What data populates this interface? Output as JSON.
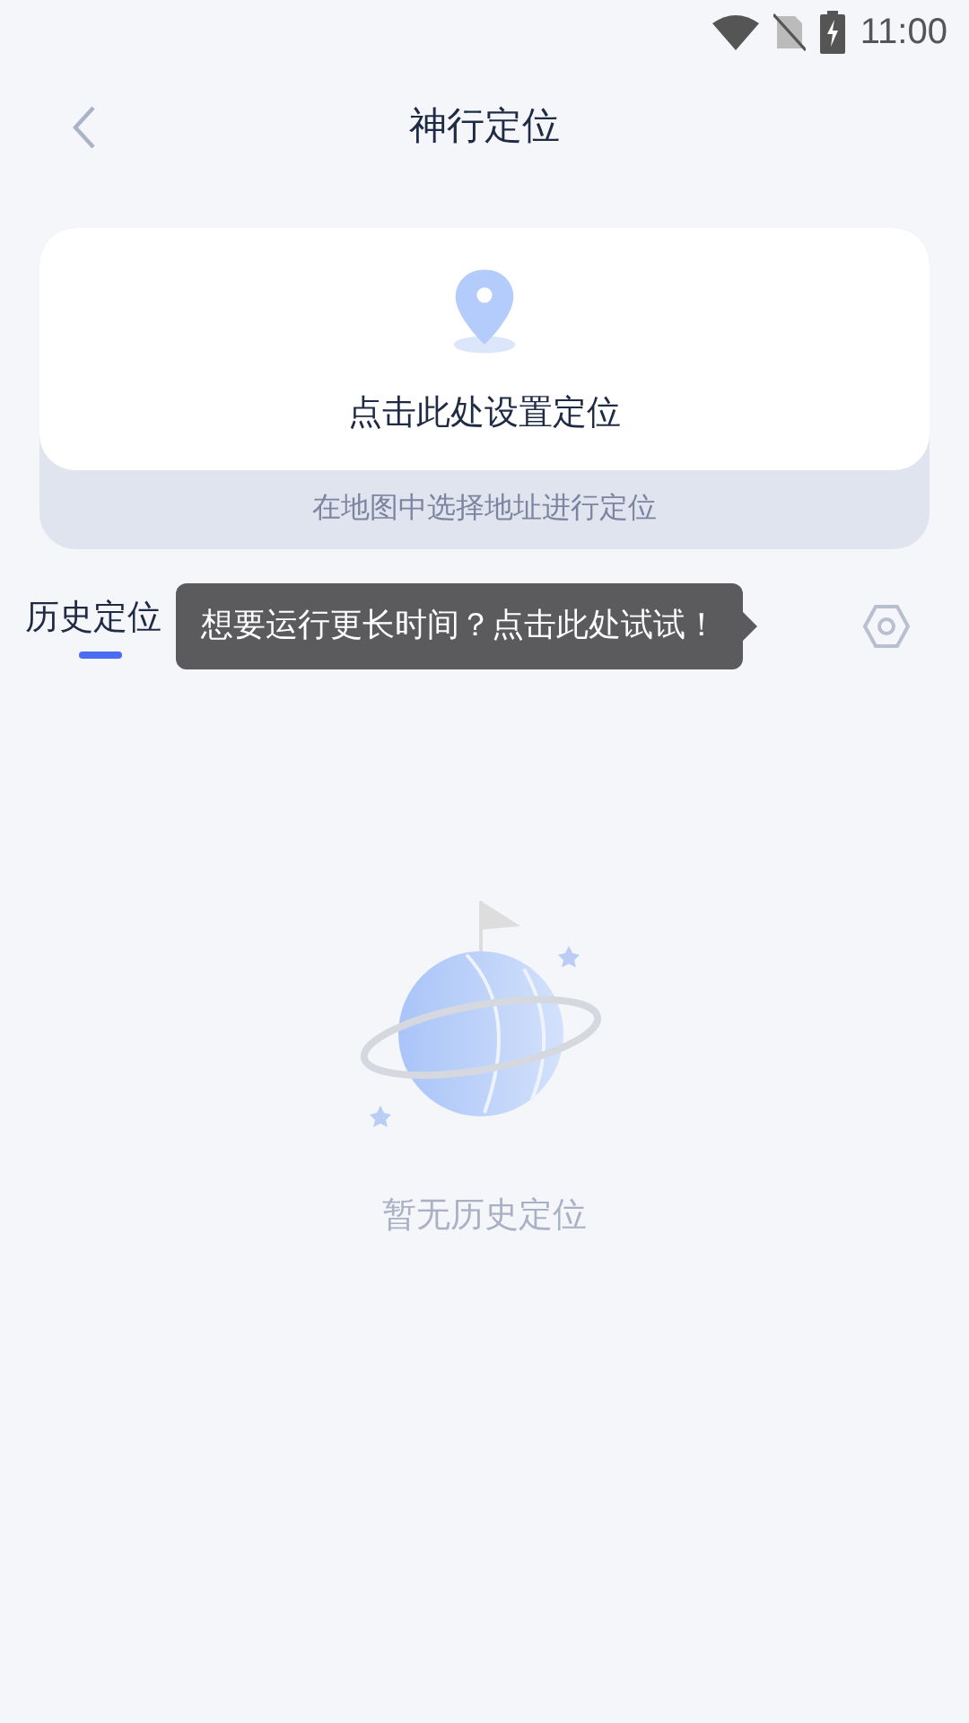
{
  "status_bar": {
    "time": "11:00"
  },
  "header": {
    "title": "神行定位"
  },
  "location_card": {
    "action": "点击此处设置定位",
    "hint": "在地图中选择地址进行定位"
  },
  "tabs": [
    {
      "label": "历史定位",
      "selected": true
    }
  ],
  "tooltip": {
    "text": "想要运行更长时间？点击此处试试！"
  },
  "empty_state": {
    "message": "暂无历史定位"
  }
}
